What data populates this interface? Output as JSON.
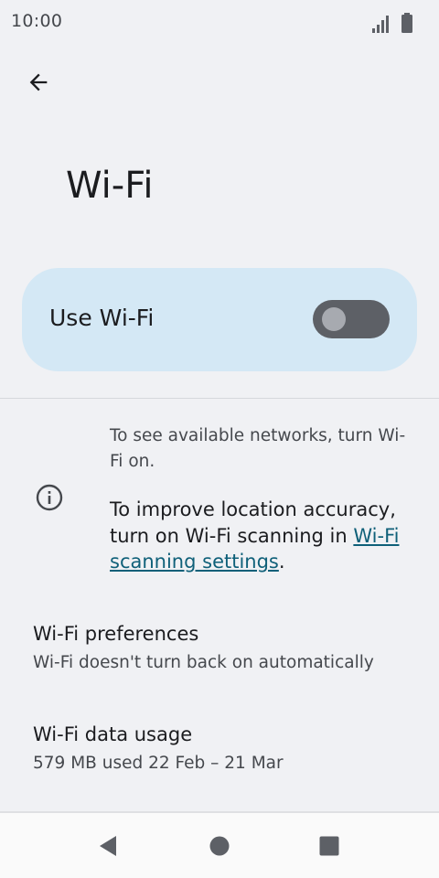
{
  "status": {
    "time": "10:00",
    "icons": [
      "signal-icon",
      "battery-icon"
    ]
  },
  "app_bar": {
    "back_icon": "arrow-back-icon",
    "title": "Wi-Fi"
  },
  "main_switch": {
    "label": "Use Wi-Fi",
    "checked": false
  },
  "info": {
    "icon": "info-icon",
    "line1": "To see available networks, turn Wi-Fi on.",
    "line2_prefix": "To improve location accuracy, turn on Wi-Fi scanning in ",
    "line2_link": "Wi-Fi scanning settings",
    "line2_suffix": "."
  },
  "preferences": [
    {
      "title": "Wi-Fi preferences",
      "summary": "Wi-Fi doesn't turn back on automatically"
    },
    {
      "title": "Wi-Fi data usage",
      "summary": "579 MB used 22 Feb – 21 Mar"
    }
  ],
  "nav": {
    "back_icon": "nav-back-icon",
    "home_icon": "nav-home-icon",
    "recents_icon": "nav-recents-icon"
  },
  "colors": {
    "background": "#f0f1f4",
    "switch_card": "#d4e8f5",
    "toggle_track": "#5d6066",
    "toggle_thumb": "#a7aab0",
    "link": "#0f6079"
  }
}
